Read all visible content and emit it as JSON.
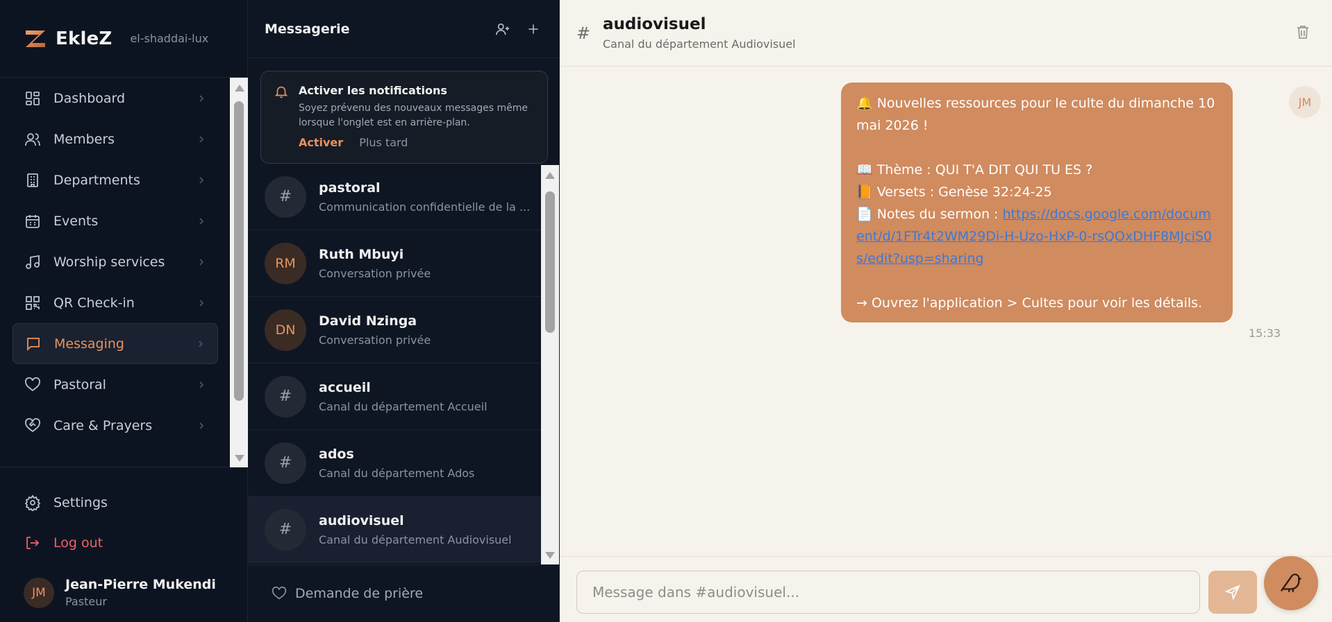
{
  "brand": {
    "name": "EkleZ",
    "org": "el-shaddai-lux"
  },
  "sidebar": {
    "items": [
      {
        "label": "Dashboard",
        "icon": "dashboard-icon"
      },
      {
        "label": "Members",
        "icon": "users-icon"
      },
      {
        "label": "Departments",
        "icon": "building-icon"
      },
      {
        "label": "Events",
        "icon": "calendar-icon"
      },
      {
        "label": "Worship services",
        "icon": "music-note-icon"
      },
      {
        "label": "QR Check-in",
        "icon": "qr-code-icon"
      },
      {
        "label": "Messaging",
        "icon": "chat-bubble-icon",
        "active": true
      },
      {
        "label": "Pastoral",
        "icon": "heart-icon"
      },
      {
        "label": "Care & Prayers",
        "icon": "heart-handshake-icon"
      }
    ],
    "settings_label": "Settings",
    "logout_label": "Log out"
  },
  "user": {
    "initials": "JM",
    "name": "Jean-Pierre Mukendi",
    "role": "Pasteur"
  },
  "conversations": {
    "title": "Messagerie",
    "notification": {
      "title": "Activer les notifications",
      "description": "Soyez prévenu des nouveaux messages même lorsque l'onglet est en arrière-plan.",
      "activate_label": "Activer",
      "later_label": "Plus tard"
    },
    "rows": [
      {
        "avatar": "#",
        "name": "pastoral",
        "subtitle": "Communication confidentielle de la ..."
      },
      {
        "avatar": "RM",
        "name": "Ruth Mbuyi",
        "subtitle": "Conversation privée"
      },
      {
        "avatar": "DN",
        "name": "David Nzinga",
        "subtitle": "Conversation privée"
      },
      {
        "avatar": "#",
        "name": "accueil",
        "subtitle": "Canal du département Accueil"
      },
      {
        "avatar": "#",
        "name": "ados",
        "subtitle": "Canal du département Ados"
      },
      {
        "avatar": "#",
        "name": "audiovisuel",
        "subtitle": "Canal du département Audiovisuel"
      }
    ],
    "footer_label": "Demande de prière"
  },
  "chat": {
    "hash": "#",
    "channel": "audiovisuel",
    "description": "Canal du département Audiovisuel",
    "message": {
      "line1": "🔔 Nouvelles ressources pour le culte du dimanche 10 mai 2026 !",
      "theme": "📖 Thème : QUI T'A DIT QUI TU ES ?",
      "verses": "📙 Versets : Genèse 32:24-25",
      "notes_prefix": "📄 Notes du sermon : ",
      "notes_link": "https://docs.google.com/document/d/1FTr4t2WM29Di-H-Uzo-HxP-0-rsQOxDHF8MJciS0s/edit?usp=sharing",
      "cta": "→ Ouvrez l'application > Cultes pour voir les détails.",
      "time": "15:33",
      "avatar": "JM"
    },
    "input_placeholder": "Message dans #audiovisuel..."
  },
  "colors": {
    "accent": "#d08b5f",
    "accent_text": "#e8935e",
    "logout": "#f0616a",
    "dark_bg": "#0d1421",
    "chat_bg": "#f6f3ec"
  }
}
